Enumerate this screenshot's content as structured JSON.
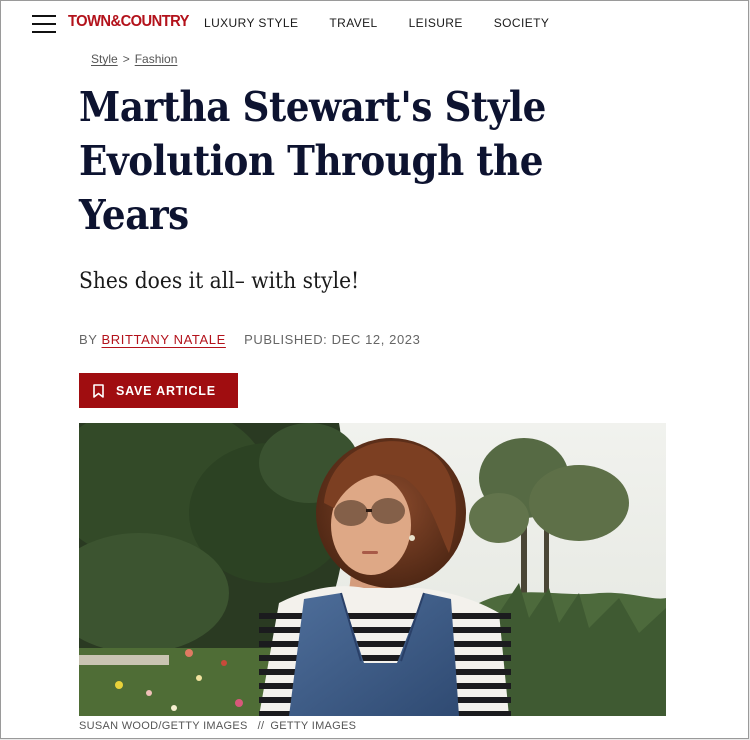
{
  "header": {
    "logo": "TOWN&COUNTRY",
    "nav": [
      "LUXURY STYLE",
      "TRAVEL",
      "LEISURE",
      "SOCIETY"
    ]
  },
  "breadcrumb": {
    "items": [
      "Style",
      "Fashion"
    ],
    "separator": ">"
  },
  "article": {
    "title": "Martha Stewart's Style Evolution Through the Years",
    "dek": "Shes does it all– with style!",
    "byline_prefix": "BY",
    "author": "BRITTANY NATALE",
    "published": "PUBLISHED: DEC 12, 2023",
    "save_label": "SAVE ARTICLE"
  },
  "photo": {
    "credit": "SUSAN WOOD/GETTY IMAGES",
    "credit_separator": "//",
    "credit_source": "GETTY IMAGES"
  },
  "colors": {
    "brand": "#b3121b",
    "button": "#a00d10",
    "title": "#0d1330"
  },
  "icons": [
    "hamburger-menu-icon",
    "bookmark-icon"
  ]
}
